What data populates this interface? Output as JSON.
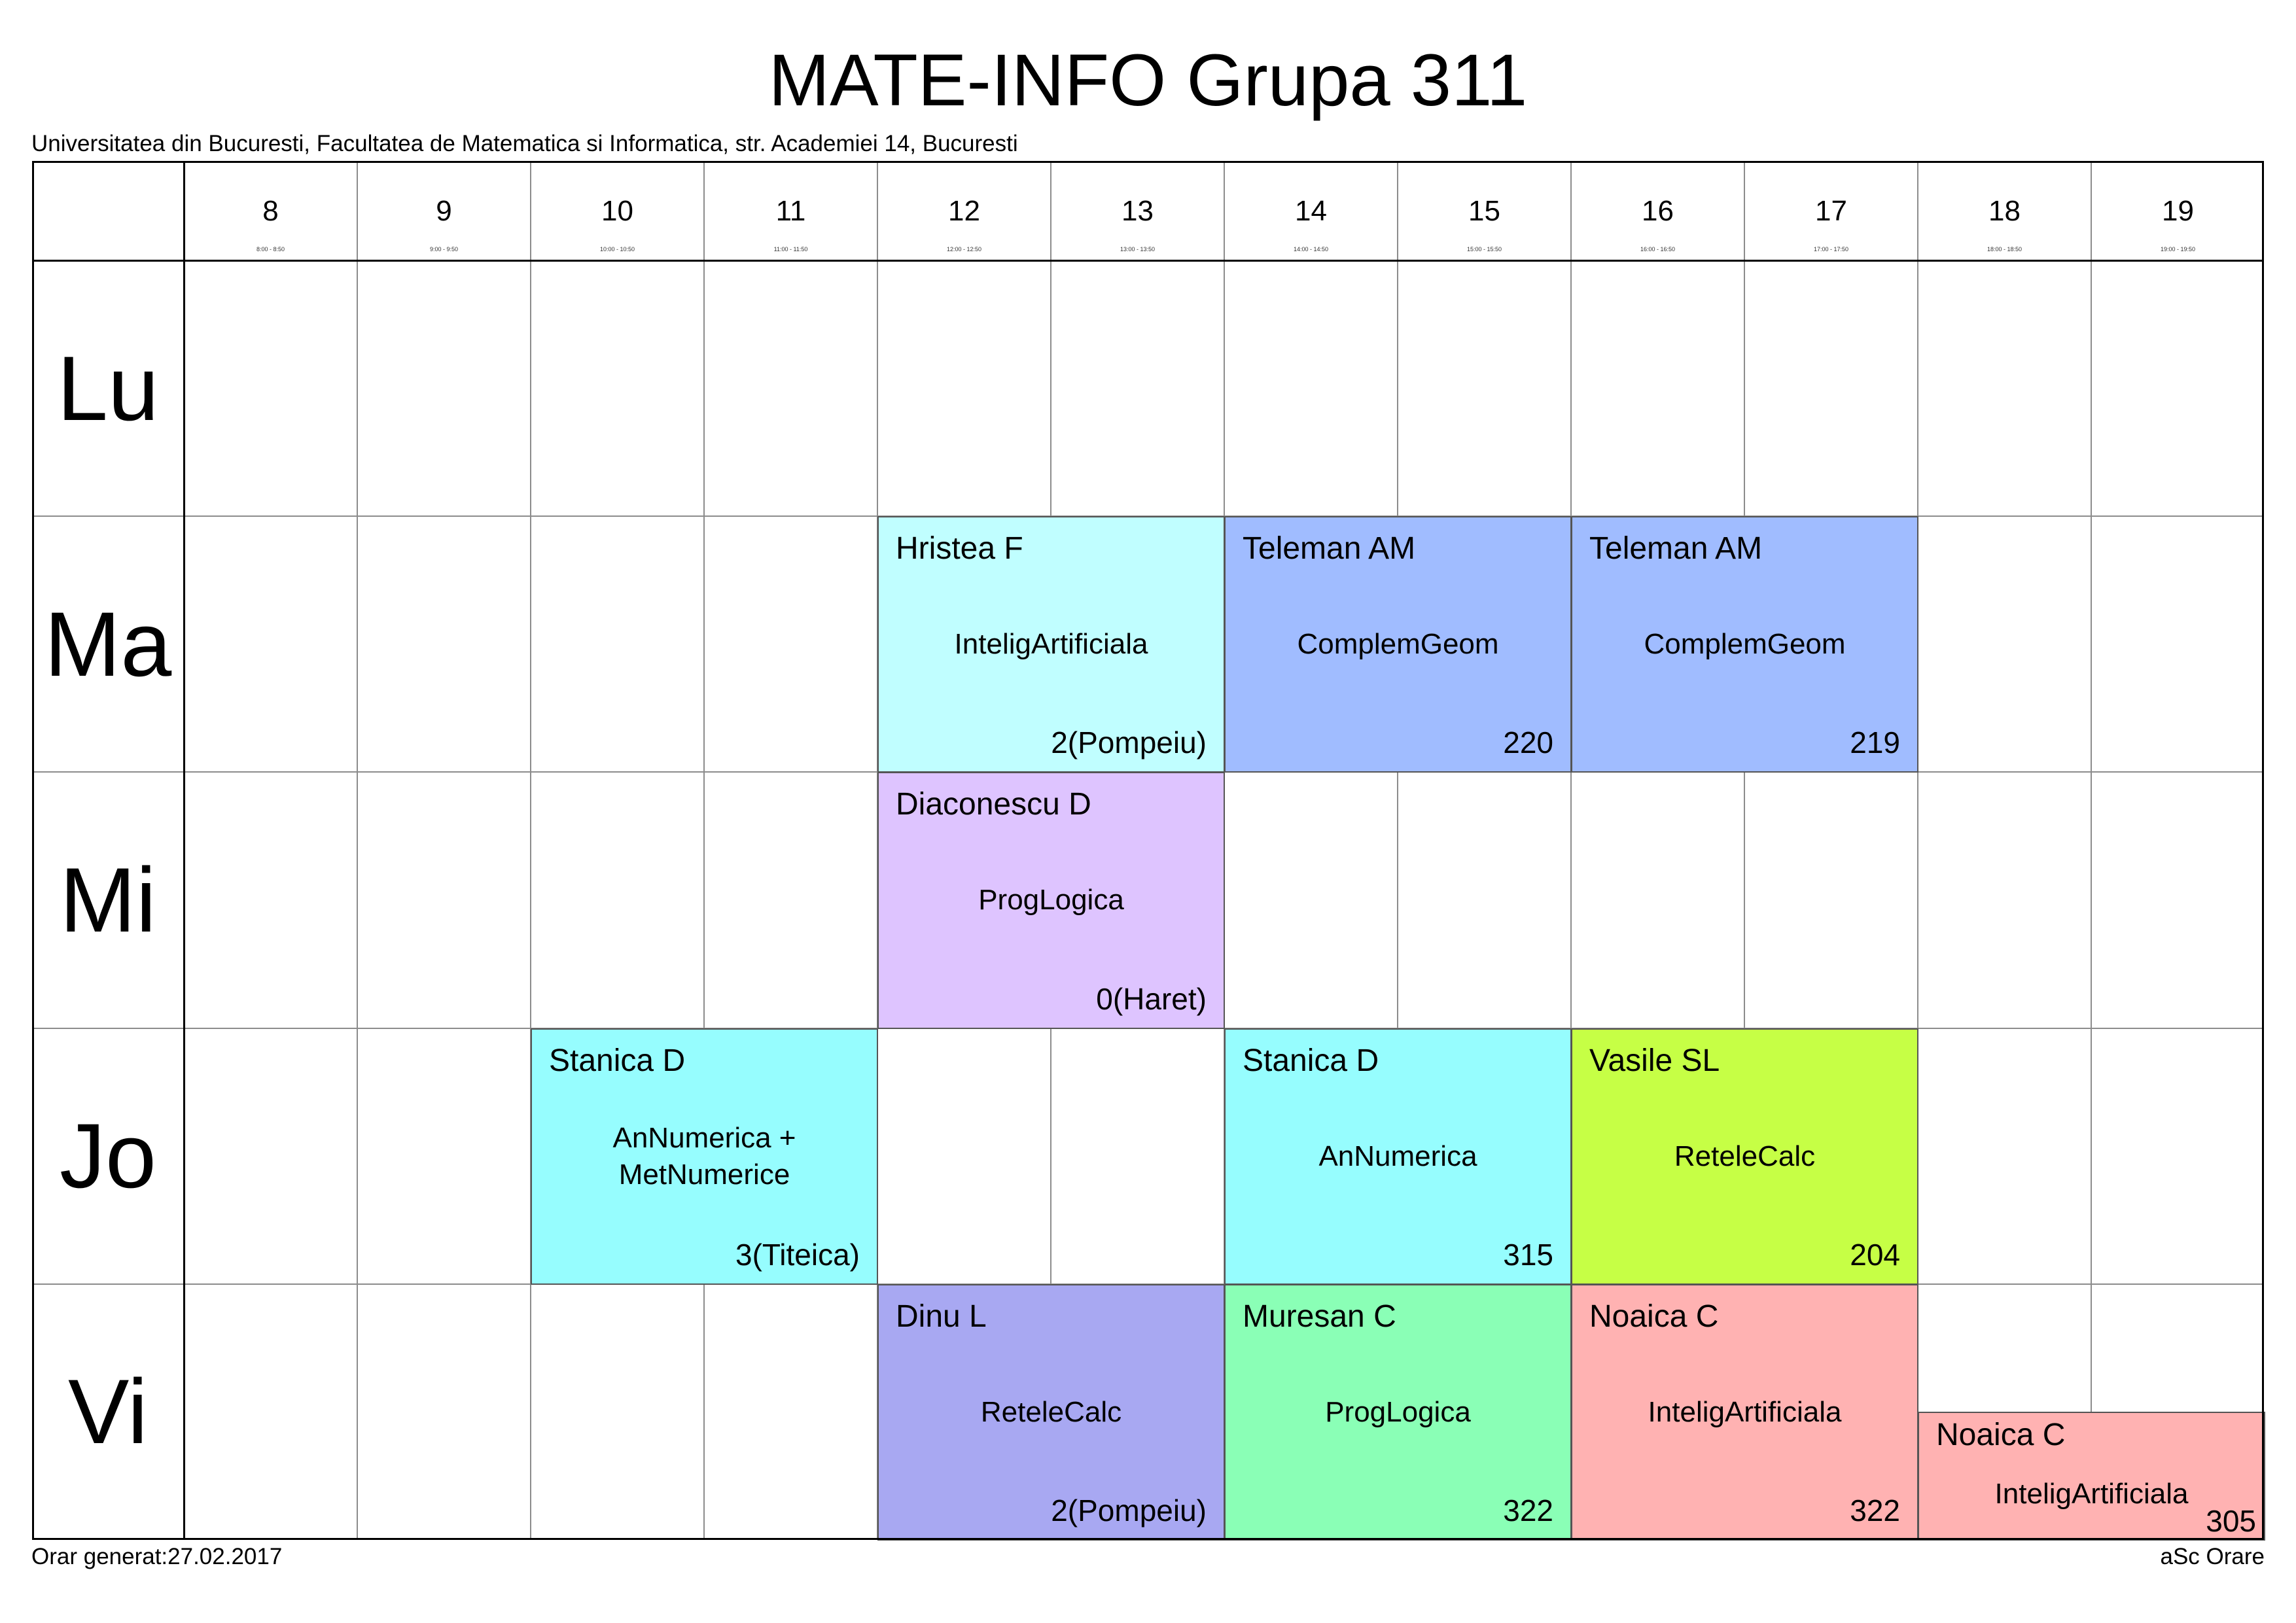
{
  "title": "MATE-INFO Grupa 311",
  "subtitle": "Universitatea din Bucuresti, Facultatea de Matematica si Informatica, str. Academiei 14, Bucuresti",
  "footer_left": "Orar generat:27.02.2017",
  "footer_right": "aSc Orare",
  "hours": [
    {
      "label": "8",
      "time": "8:00 - 8:50"
    },
    {
      "label": "9",
      "time": "9:00 - 9:50"
    },
    {
      "label": "10",
      "time": "10:00 - 10:50"
    },
    {
      "label": "11",
      "time": "11:00 - 11:50"
    },
    {
      "label": "12",
      "time": "12:00 - 12:50"
    },
    {
      "label": "13",
      "time": "13:00 - 13:50"
    },
    {
      "label": "14",
      "time": "14:00 - 14:50"
    },
    {
      "label": "15",
      "time": "15:00 - 15:50"
    },
    {
      "label": "16",
      "time": "16:00 - 16:50"
    },
    {
      "label": "17",
      "time": "17:00 - 17:50"
    },
    {
      "label": "18",
      "time": "18:00 - 18:50"
    },
    {
      "label": "19",
      "time": "19:00 - 19:50"
    }
  ],
  "days": [
    "Lu",
    "Ma",
    "Mi",
    "Jo",
    "Vi"
  ],
  "lessons": [
    {
      "day": 1,
      "start": 4,
      "span": 2,
      "teacher": "Hristea F",
      "subject": "InteligArtificiala",
      "room": "2(Pompeiu)",
      "color": "#c0feff"
    },
    {
      "day": 1,
      "start": 6,
      "span": 2,
      "teacher": "Teleman AM",
      "subject": "ComplemGeom",
      "room": "220",
      "color": "#a0bcff"
    },
    {
      "day": 1,
      "start": 8,
      "span": 2,
      "teacher": "Teleman AM",
      "subject": "ComplemGeom",
      "room": "219",
      "color": "#a0bcff"
    },
    {
      "day": 2,
      "start": 4,
      "span": 2,
      "teacher": "Diaconescu D",
      "subject": "ProgLogica",
      "room": "0(Haret)",
      "color": "#dec4ff"
    },
    {
      "day": 3,
      "start": 2,
      "span": 2,
      "teacher": "Stanica D",
      "subject": "AnNumerica +\nMetNumerice",
      "room": "3(Titeica)",
      "color": "#96fdfe"
    },
    {
      "day": 3,
      "start": 6,
      "span": 2,
      "teacher": "Stanica D",
      "subject": "AnNumerica",
      "room": "315",
      "color": "#96fdfe"
    },
    {
      "day": 3,
      "start": 8,
      "span": 2,
      "teacher": "Vasile SL",
      "subject": "ReteleCalc",
      "room": "204",
      "color": "#c6ff45"
    },
    {
      "day": 4,
      "start": 4,
      "span": 2,
      "teacher": "Dinu L",
      "subject": "ReteleCalc",
      "room": "2(Pompeiu)",
      "color": "#a8a8f2"
    },
    {
      "day": 4,
      "start": 6,
      "span": 2,
      "teacher": "Muresan C",
      "subject": "ProgLogica",
      "room": "322",
      "color": "#8affb6"
    },
    {
      "day": 4,
      "start": 8,
      "span": 2,
      "teacher": "Noaica C",
      "subject": "InteligArtificiala",
      "room": "322",
      "color": "#ffb2b2"
    },
    {
      "day": 4,
      "start": 10,
      "span": 2,
      "half": "bottom",
      "teacher": "Noaica C",
      "subject": "InteligArtificiala",
      "room": "305",
      "color": "#ffb2b2"
    }
  ]
}
